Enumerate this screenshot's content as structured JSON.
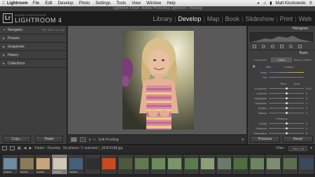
{
  "menubar": {
    "apple": "",
    "app": "Lightroom",
    "items": [
      "File",
      "Edit",
      "Develop",
      "Photo",
      "Settings",
      "Tools",
      "View",
      "Window",
      "Help"
    ],
    "user": "Matt Kloskowski"
  },
  "window_title": "Lightroom 4.lrcat - Adobe Photoshop Lightroom - Develop",
  "identity": {
    "logo": "Lr",
    "small": "ADOBE PHOTOSHOP",
    "big": "LIGHTROOM 4"
  },
  "modules": [
    "Library",
    "Develop",
    "Map",
    "Book",
    "Slideshow",
    "Print",
    "Web"
  ],
  "active_module": "Develop",
  "left_panel": {
    "navigator": "Navigator",
    "nav_zoom": "FIT  FILL  1:1  3:1",
    "presets": "Presets",
    "snapshots": "Snapshots",
    "history": "History",
    "collections": "Collections",
    "copy": "Copy...",
    "paste": "Paste"
  },
  "toolbar": {
    "soft_proofing": "Soft Proofing"
  },
  "right_panel": {
    "histogram": "Histogram",
    "basic": "Basic",
    "treatment_tabs": [
      "Treatment:",
      "Color",
      "Black & White"
    ],
    "wb_label": "WB :",
    "wb_value": "Custom",
    "temp_label": "Temp",
    "tint_label": "Tint",
    "tone_label": "Tone",
    "auto_label": "Auto",
    "tone_sliders": [
      {
        "label": "Exposure",
        "value": "0.00",
        "pos": 0.5
      },
      {
        "label": "Contrast",
        "value": "0",
        "pos": 0.5
      },
      {
        "label": "Highlights",
        "value": "0",
        "pos": 0.5
      },
      {
        "label": "Shadows",
        "value": "0",
        "pos": 0.5
      },
      {
        "label": "Whites",
        "value": "0",
        "pos": 0.5
      },
      {
        "label": "Blacks",
        "value": "0",
        "pos": 0.5
      }
    ],
    "presence_label": "Presence",
    "presence_sliders": [
      {
        "label": "Clarity",
        "value": "0",
        "pos": 0.5
      },
      {
        "label": "Vibrance",
        "value": "0",
        "pos": 0.5
      },
      {
        "label": "Saturation",
        "value": "0",
        "pos": 0.5
      }
    ],
    "previous": "Previous",
    "reset": "Reset"
  },
  "filmstrip_bar": {
    "folder": "Folder : Develop",
    "count": "56 photos / 1 selected / _MJK4148.jpg",
    "filter_label": "Filter :",
    "filter_value": "Filters Off"
  },
  "filmstrip": {
    "selected_index": 3,
    "thumb_colors": [
      "#6d8aa0",
      "#8a7b5a",
      "#c9a47a",
      "#cfc7b8",
      "#45607a",
      "#2f2f2f",
      "#c84a1e",
      "#4a5a3a",
      "#5f7a4f",
      "#6c8a5a",
      "#7a946a",
      "#587c4a",
      "#8a9f78",
      "#6a7a6a",
      "#4f6f3f",
      "#6b8660",
      "#7d8d70",
      "#5c6e4e",
      "#3a4a5a"
    ]
  }
}
